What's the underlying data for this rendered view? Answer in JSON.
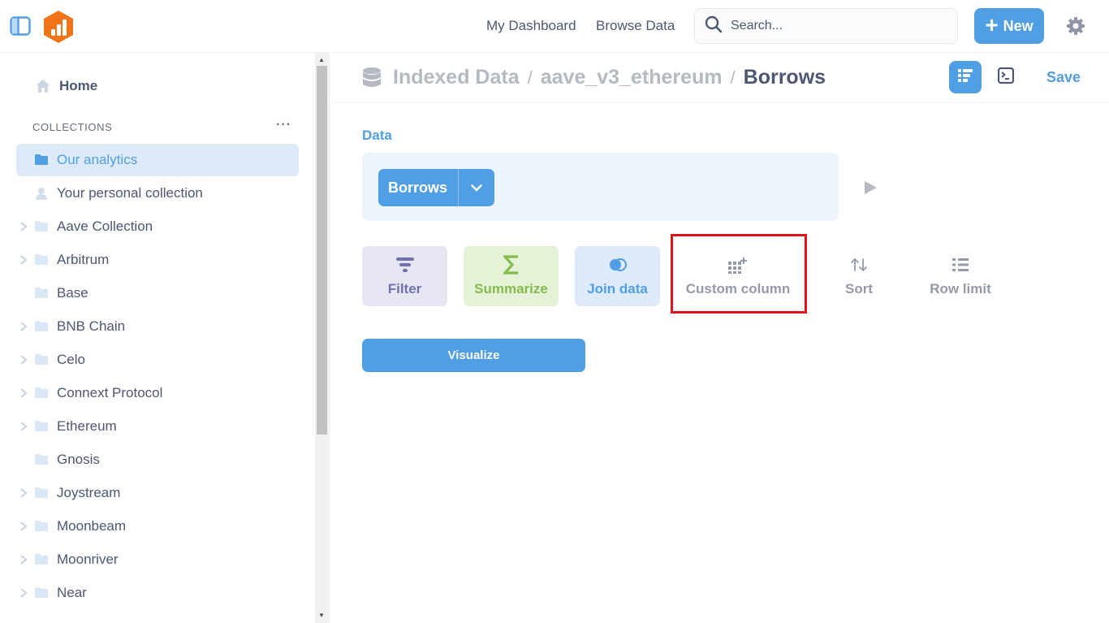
{
  "topbar": {
    "nav": [
      "My Dashboard",
      "Browse Data"
    ],
    "search_placeholder": "Search...",
    "new_label": "New"
  },
  "sidebar": {
    "home_label": "Home",
    "collections_header": "COLLECTIONS",
    "more_label": "···",
    "collections": [
      {
        "label": "Our analytics",
        "active": true,
        "expandable": false,
        "icon": "folder-icon"
      },
      {
        "label": "Your personal collection",
        "active": false,
        "expandable": false,
        "icon": "person-icon"
      },
      {
        "label": "Aave Collection",
        "active": false,
        "expandable": true,
        "icon": "folder-icon"
      },
      {
        "label": "Arbitrum",
        "active": false,
        "expandable": true,
        "icon": "folder-icon"
      },
      {
        "label": "Base",
        "active": false,
        "expandable": false,
        "icon": "folder-icon"
      },
      {
        "label": "BNB Chain",
        "active": false,
        "expandable": true,
        "icon": "folder-icon"
      },
      {
        "label": "Celo",
        "active": false,
        "expandable": true,
        "icon": "folder-icon"
      },
      {
        "label": "Connext Protocol",
        "active": false,
        "expandable": true,
        "icon": "folder-icon"
      },
      {
        "label": "Ethereum",
        "active": false,
        "expandable": true,
        "icon": "folder-icon"
      },
      {
        "label": "Gnosis",
        "active": false,
        "expandable": false,
        "icon": "folder-icon"
      },
      {
        "label": "Joystream",
        "active": false,
        "expandable": true,
        "icon": "folder-icon"
      },
      {
        "label": "Moonbeam",
        "active": false,
        "expandable": true,
        "icon": "folder-icon"
      },
      {
        "label": "Moonriver",
        "active": false,
        "expandable": true,
        "icon": "folder-icon"
      },
      {
        "label": "Near",
        "active": false,
        "expandable": true,
        "icon": "folder-icon"
      }
    ]
  },
  "header": {
    "breadcrumb": [
      "Indexed Data",
      "aave_v3_ethereum"
    ],
    "separator": "/",
    "title": "Borrows",
    "save_label": "Save"
  },
  "editor": {
    "data_label": "Data",
    "table_name": "Borrows",
    "actions": {
      "filter": "Filter",
      "summarize": "Summarize",
      "join": "Join data",
      "custom_column": "Custom column",
      "sort": "Sort",
      "row_limit": "Row limit"
    },
    "visualize_label": "Visualize"
  },
  "colors": {
    "brand": "#509ee3",
    "filter": "#7172ad",
    "summarize": "#84bb4c",
    "highlight": "#e0121b",
    "logo": "#f27418"
  }
}
